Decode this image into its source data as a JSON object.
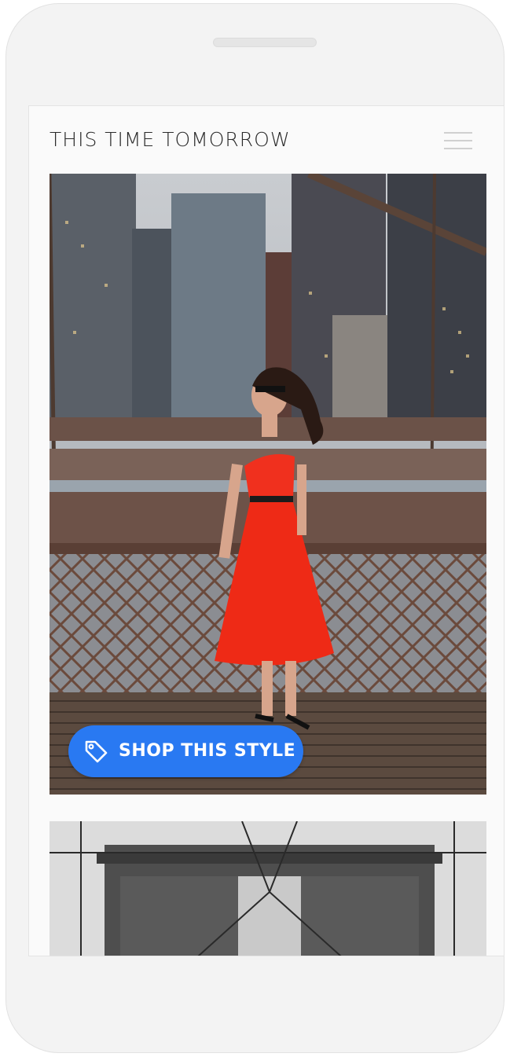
{
  "app": {
    "brand_title": "THIS TIME TOMORROW"
  },
  "header": {
    "menu_icon": "hamburger-menu-icon"
  },
  "hero": {
    "image_subject": "woman in red off-shoulder dress on Brooklyn Bridge walkway",
    "shop_button_label": "SHOP THIS STYLE",
    "shop_button_icon": "tag-icon",
    "accent_color": "#2979f2"
  },
  "second_image": {
    "image_subject": "Brooklyn Bridge tower black and white"
  }
}
